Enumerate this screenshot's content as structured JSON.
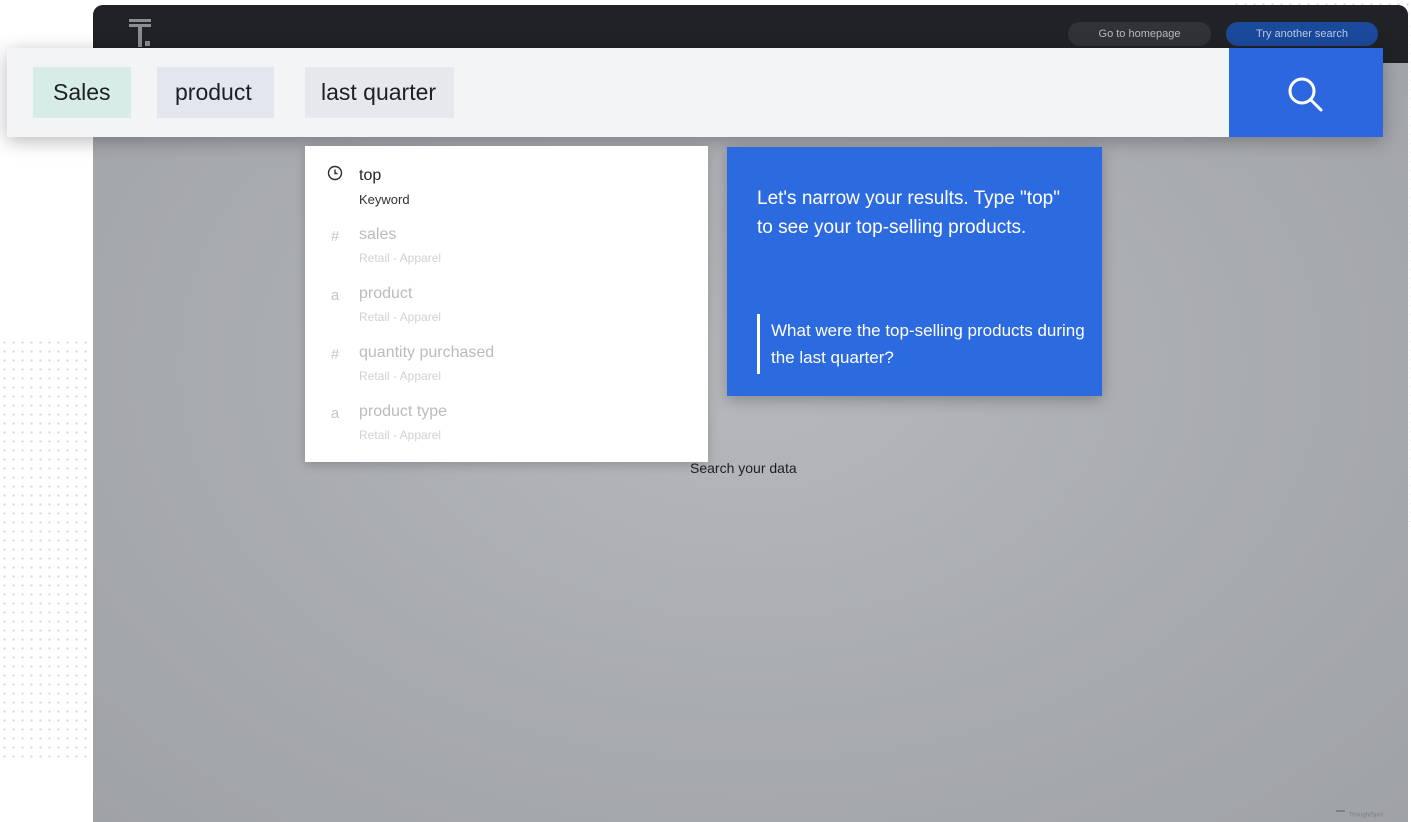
{
  "topbar": {
    "home_button": "Go to homepage",
    "try_button": "Try another search"
  },
  "search": {
    "tokens": [
      "Sales",
      "product",
      "last quarter"
    ],
    "button_icon": "search-icon"
  },
  "suggestions": [
    {
      "icon": "clock-icon",
      "glyph": "",
      "name": "top",
      "source": "Keyword"
    },
    {
      "icon": "measure-icon",
      "glyph": "#",
      "name": "sales",
      "source": "Retail - Apparel"
    },
    {
      "icon": "attribute-icon",
      "glyph": "a",
      "name": "product",
      "source": "Retail - Apparel"
    },
    {
      "icon": "measure-icon",
      "glyph": "#",
      "name": "quantity purchased",
      "source": "Retail - Apparel"
    },
    {
      "icon": "attribute-icon",
      "glyph": "a",
      "name": "product type",
      "source": "Retail - Apparel"
    }
  ],
  "callout": {
    "text": "Let's narrow your results. Type \"top\" to see your top-selling products.",
    "question": "What were the top-selling products during the last quarter?"
  },
  "main": {
    "center_label": "Search your data"
  },
  "watermark": "ThoughtSpot",
  "colors": {
    "accent": "#2d67e0",
    "topbar": "#202226",
    "backdrop": "#a3a6ab"
  }
}
